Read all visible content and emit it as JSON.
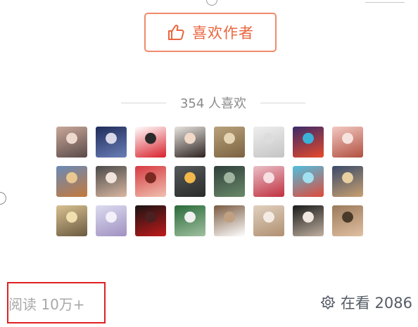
{
  "header": {
    "like_author_button": {
      "icon": "thumbs-up-icon",
      "label": "喜欢作者"
    }
  },
  "likes": {
    "summary": "354 人喜欢",
    "avatars": [
      {
        "name": "avatar-1",
        "colors": [
          "#c9a79a",
          "#5a4a48",
          "#efd9cf"
        ]
      },
      {
        "name": "avatar-2",
        "colors": [
          "#1f2c5a",
          "#6a7fb8",
          "#d8d8e8"
        ]
      },
      {
        "name": "avatar-3",
        "colors": [
          "#ffffff",
          "#d8202a",
          "#2a2a2a"
        ]
      },
      {
        "name": "avatar-4",
        "colors": [
          "#e8e4e0",
          "#2d2320",
          "#f1d9c9"
        ]
      },
      {
        "name": "avatar-5",
        "colors": [
          "#b9a27a",
          "#7b6242",
          "#e6d5b5"
        ]
      },
      {
        "name": "avatar-6",
        "colors": [
          "#eeeeee",
          "#c4c4c4",
          "#dcdcdc"
        ]
      },
      {
        "name": "avatar-7",
        "colors": [
          "#3a2a6a",
          "#e84a2a",
          "#3bb0d8"
        ]
      },
      {
        "name": "avatar-8",
        "colors": [
          "#f3c9c2",
          "#b05040",
          "#f7e3de"
        ]
      },
      {
        "name": "avatar-9",
        "colors": [
          "#6a8ab8",
          "#c47a3a",
          "#e8c890"
        ]
      },
      {
        "name": "avatar-10",
        "colors": [
          "#4a4a4a",
          "#d9b7a0",
          "#f1e4dc"
        ]
      },
      {
        "name": "avatar-11",
        "colors": [
          "#d63a40",
          "#f0c0b0",
          "#7a2a20"
        ]
      },
      {
        "name": "avatar-12",
        "colors": [
          "#555a5a",
          "#2a2a2a",
          "#f2b84a"
        ]
      },
      {
        "name": "avatar-13",
        "colors": [
          "#2f3f3a",
          "#6a8a6a",
          "#a0b4a0"
        ]
      },
      {
        "name": "avatar-14",
        "colors": [
          "#e9c0c8",
          "#c03040",
          "#f7dfe4"
        ]
      },
      {
        "name": "avatar-15",
        "colors": [
          "#4ec0e0",
          "#e04a3a",
          "#a0e0f0"
        ]
      },
      {
        "name": "avatar-16",
        "colors": [
          "#3a4a6a",
          "#c9a070",
          "#e8d0a0"
        ]
      },
      {
        "name": "avatar-17",
        "colors": [
          "#d8c090",
          "#6a5a40",
          "#f0e0b0"
        ]
      },
      {
        "name": "avatar-18",
        "colors": [
          "#dcdcf0",
          "#a090c0",
          "#f4f0fa"
        ]
      },
      {
        "name": "avatar-19",
        "colors": [
          "#1a1414",
          "#c01a1a",
          "#4a2020"
        ]
      },
      {
        "name": "avatar-20",
        "colors": [
          "#2a6a3a",
          "#a0c0a0",
          "#f0f0f0"
        ]
      },
      {
        "name": "avatar-21",
        "colors": [
          "#7a5a40",
          "#ffffff",
          "#c0a080"
        ]
      },
      {
        "name": "avatar-22",
        "colors": [
          "#e0d0c0",
          "#b09070",
          "#f4ece4"
        ]
      },
      {
        "name": "avatar-23",
        "colors": [
          "#1a1a1a",
          "#c0b0a0",
          "#f0e8e0"
        ]
      },
      {
        "name": "avatar-24",
        "colors": [
          "#9a7a5a",
          "#e0c0a0",
          "#4a3a2a"
        ]
      }
    ]
  },
  "footer": {
    "read_count": "阅读 10万+",
    "watching": {
      "icon": "flower-icon",
      "label": "在看 2086"
    }
  },
  "colors": {
    "accent": "#e9663f",
    "highlight_box": "#e02020",
    "muted_text": "#a8a8a8"
  }
}
